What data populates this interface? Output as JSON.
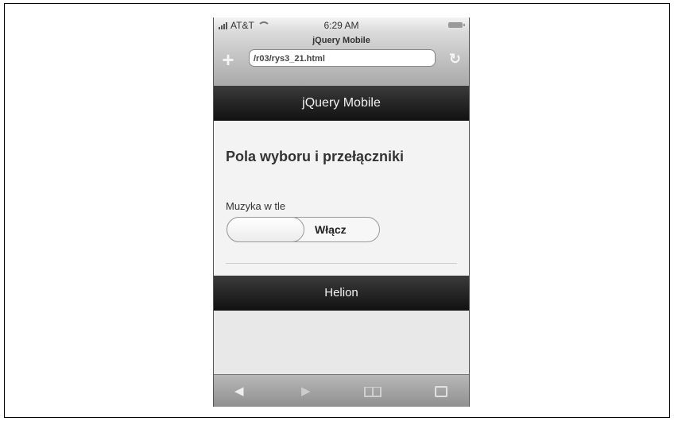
{
  "status": {
    "carrier": "AT&T",
    "time": "6:29 AM"
  },
  "browser": {
    "page_title": "jQuery Mobile",
    "url": "/r03/rys3_21.html",
    "new_tab_icon": "plus-icon",
    "reload_icon": "reload-icon"
  },
  "header": {
    "title": "jQuery Mobile"
  },
  "content": {
    "heading": "Pola wyboru i przełączniki",
    "field_label": "Muzyka w tle",
    "switch_label": "Włącz"
  },
  "footer": {
    "title": "Helion"
  },
  "toolbar": {
    "icons": [
      "back-icon",
      "forward-icon",
      "bookmarks-icon",
      "pages-icon"
    ]
  }
}
